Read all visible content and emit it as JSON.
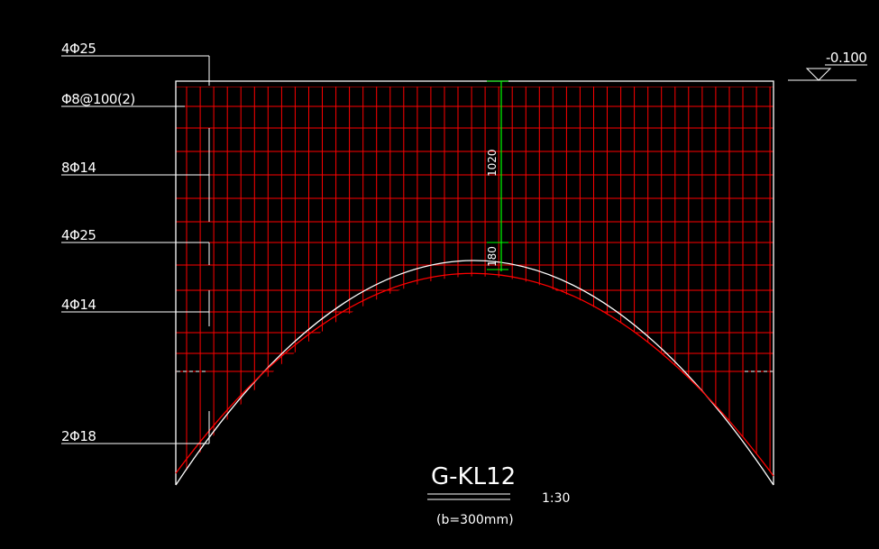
{
  "drawing": {
    "title": "G-KL12",
    "subtitle": "(b=300mm)",
    "scale": "1:30",
    "elevation": "-0.100"
  },
  "rebar_labels": [
    {
      "id": "top-bars",
      "text": "4Φ25"
    },
    {
      "id": "stirrups",
      "text": "Φ8@100(2)"
    },
    {
      "id": "side-bars",
      "text": "8Φ14"
    },
    {
      "id": "middle-bars",
      "text": "4Φ25"
    },
    {
      "id": "lower-side-bars",
      "text": "4Φ14"
    },
    {
      "id": "bottom-bars",
      "text": "2Φ18"
    }
  ],
  "dimensions": {
    "upper": "1020",
    "lower": "180"
  },
  "colors": {
    "background": "#000000",
    "outline": "#ffffff",
    "rebar": "#ff0000",
    "dimension": "#00ff00"
  }
}
